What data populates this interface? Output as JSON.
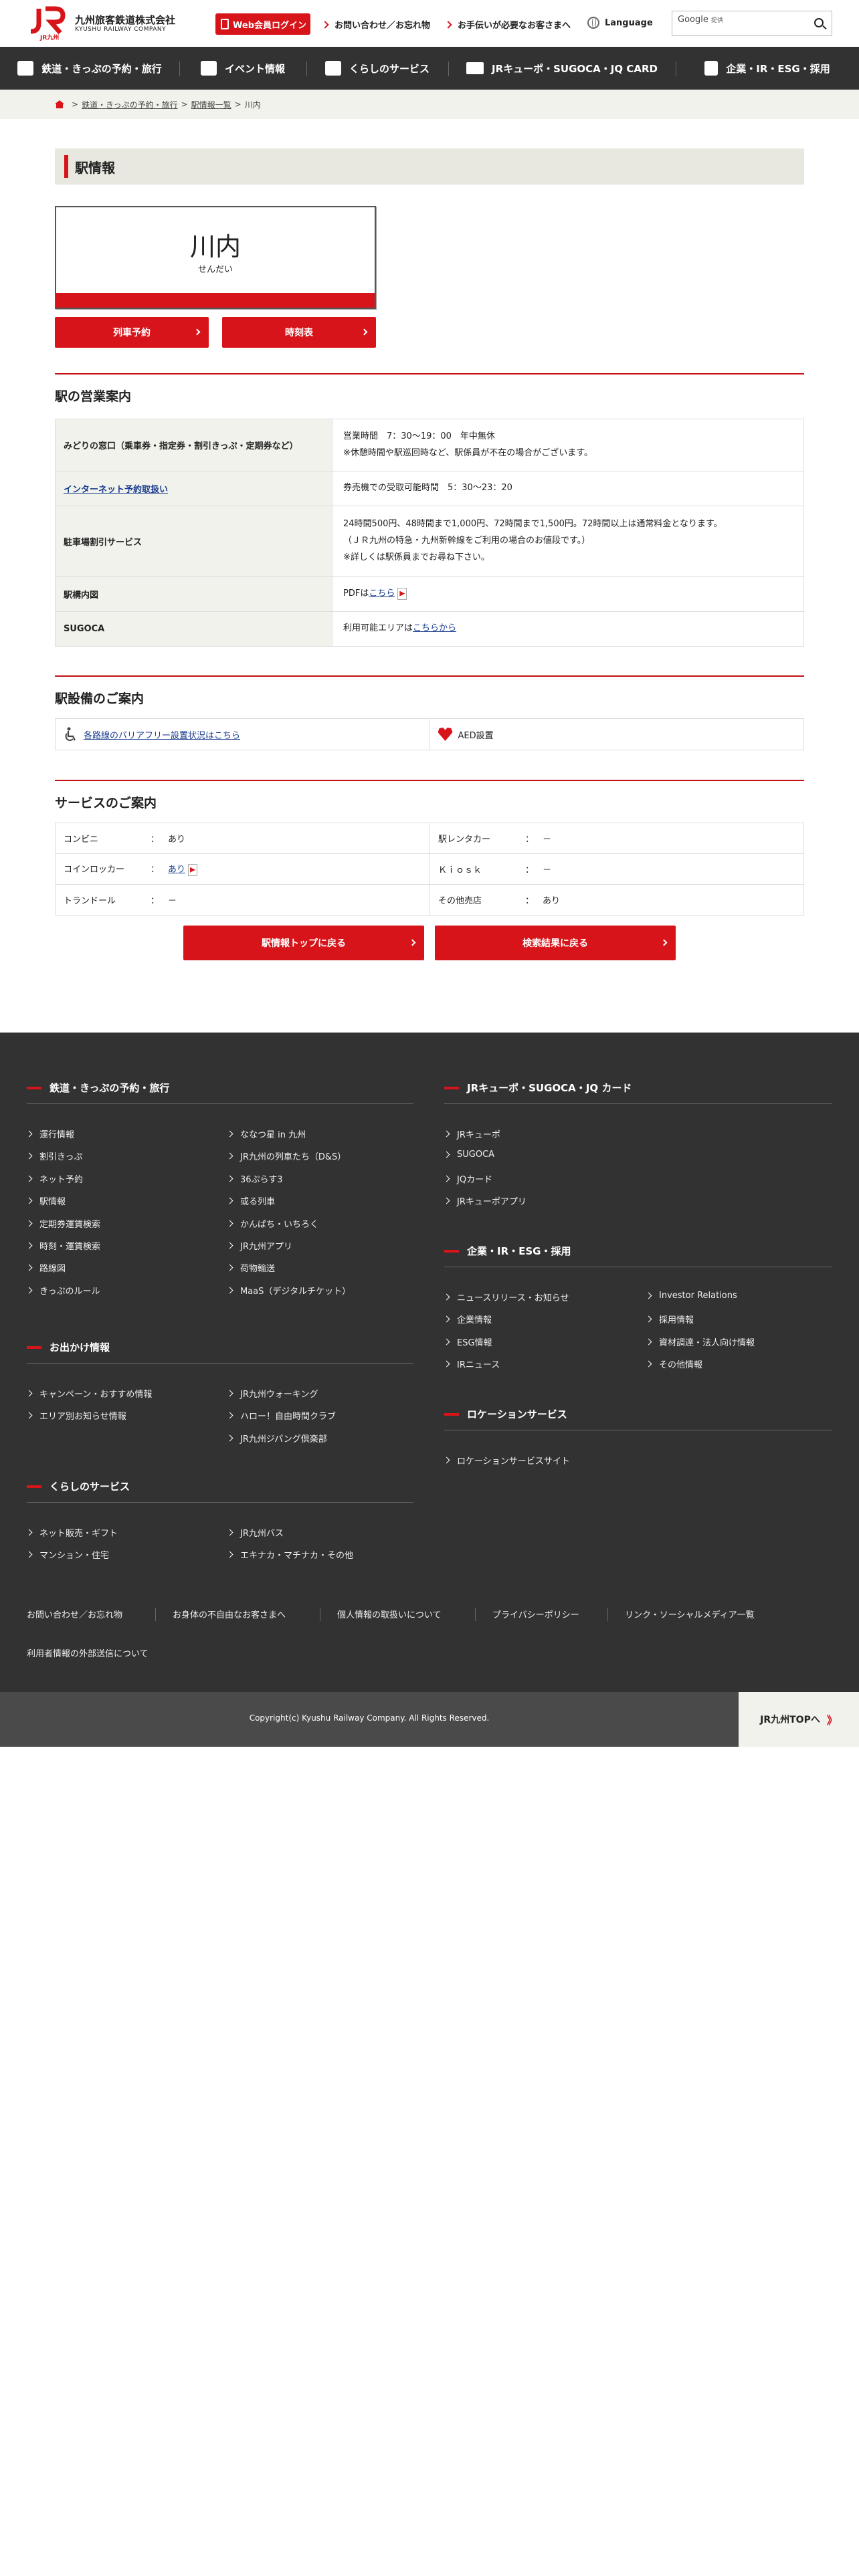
{
  "header": {
    "logo_jp": "九州旅客鉄道株式会社",
    "logo_en": "KYUSHU RAILWAY COMPANY",
    "logo_mark": "JR九州",
    "login_label": "Web会員ログイン",
    "contact_label": "お問い合わせ／お忘れ物",
    "assist_label": "お手伝いが必要なお客さまへ",
    "language_label": "Language",
    "search_brand": "Google",
    "search_brand_sub": "提供"
  },
  "nav": {
    "items": [
      {
        "label": "鉄道・きっぷの予約・旅行",
        "icon": "train-icon"
      },
      {
        "label": "イベント情報",
        "icon": "bag-icon"
      },
      {
        "label": "くらしのサービス",
        "icon": "box-icon"
      },
      {
        "label": "JRキューポ・SUGOCA・JQ CARD",
        "icon": "card-icon"
      },
      {
        "label": "企業・IR・ESG・採用",
        "icon": "building-icon"
      }
    ]
  },
  "breadcrumb": {
    "items": [
      "鉄道・きっぷの予約・旅行",
      "駅情報一覧",
      "川内"
    ],
    "separator": ">"
  },
  "main": {
    "page_title": "駅情報",
    "station": {
      "name": "川内",
      "kana": "せんだい"
    },
    "buttons": {
      "reserve": "列車予約",
      "timetable": "時刻表"
    },
    "business": {
      "heading": "駅の営業案内",
      "rows": [
        {
          "label": "みどりの窓口（乗車券・指定券・割引きっぷ・定期券など）",
          "line1": "営業時間　7：30〜19：00　年中無休",
          "line2": "※休憩時間や駅巡回時など、駅係員が不在の場合がございます。"
        },
        {
          "label": "インターネット予約取扱い",
          "line1": "券売機での受取可能時間　5：30〜23：20"
        },
        {
          "label": "駐車場割引サービス",
          "line1": "24時間500円、48時間まで1,000円、72時間まで1,500円。72時間以上は通常料金となります。",
          "line2": "（ＪＲ九州の特急・九州新幹線をご利用の場合のお値段です。）",
          "line3": "※詳しくは駅係員までお尋ね下さい。"
        },
        {
          "label": "駅構内図",
          "prefix": "PDFは",
          "link": "こちら"
        },
        {
          "label": "SUGOCA",
          "prefix": "利用可能エリアは",
          "link": "こちらから"
        }
      ]
    },
    "facilities": {
      "heading": "駅設備のご案内",
      "barrier_free": "各路線のバリアフリー設置状況はこちら",
      "aed": "AED設置"
    },
    "services": {
      "heading": "サービスのご案内",
      "colon": "：",
      "rows": [
        [
          {
            "k": "コンビニ",
            "v": "あり"
          },
          {
            "k": "駅レンタカー",
            "v": "－"
          }
        ],
        [
          {
            "k": "コインロッカー",
            "v": "あり"
          },
          {
            "k": "Ｋｉｏｓｋ",
            "v": "－"
          }
        ],
        [
          {
            "k": "トランドール",
            "v": "－"
          },
          {
            "k": "その他売店",
            "v": "あり"
          }
        ]
      ]
    },
    "bottom_buttons": {
      "back_top": "駅情報トップに戻る",
      "back_results": "検索結果に戻る"
    }
  },
  "footer": {
    "sections": {
      "rail": {
        "title": "鉄道・きっぷの予約・旅行",
        "col1": [
          "運行情報",
          "割引きっぷ",
          "ネット予約",
          "駅情報",
          "定期券運賃検索",
          "時刻・運賃検索",
          "路線図",
          "きっぷのルール"
        ],
        "col2": [
          "ななつ星 in 九州",
          "JR九州の列車たち（D&S）",
          "36ぷらす3",
          "或る列車",
          "かんぱち・いちろく",
          "JR九州アプリ",
          "荷物輸送",
          "MaaS（デジタルチケット）"
        ]
      },
      "outing": {
        "title": "お出かけ情報",
        "col1": [
          "キャンペーン・おすすめ情報",
          "エリア別お知らせ情報"
        ],
        "col2": [
          "JR九州ウォーキング",
          "ハロー！自由時間クラブ",
          "JR九州ジパング倶楽部"
        ]
      },
      "living": {
        "title": "くらしのサービス",
        "col1": [
          "ネット販売・ギフト",
          "マンション・住宅"
        ],
        "col2": [
          "JR九州バス",
          "エキナカ・マチナカ・その他"
        ]
      },
      "qpo": {
        "title": "JRキューポ・SUGOCA・JQ カード",
        "col1": [
          "JRキューポ",
          "SUGOCA",
          "JQカード",
          "JRキューポアプリ"
        ]
      },
      "corp": {
        "title": "企業・IR・ESG・採用",
        "col1": [
          "ニュースリリース・お知らせ",
          "企業情報",
          "ESG情報",
          "IRニュース"
        ],
        "col2": [
          "Investor Relations",
          "採用情報",
          "資材調達・法人向け情報",
          "その他情報"
        ]
      },
      "location": {
        "title": "ロケーションサービス",
        "col1": [
          "ロケーションサービスサイト"
        ]
      }
    },
    "bottom_links": [
      "お問い合わせ／お忘れ物",
      "お身体の不自由なお客さまへ",
      "個人情報の取扱いについて",
      "プライバシーポリシー",
      "リンク・ソーシャルメディア一覧",
      "利用者情報の外部送信について"
    ],
    "copyright": "Copyright(c) Kyushu Railway Company. All Rights Reserved.",
    "top_label": "JR九州TOPへ",
    "top_arrow": "》"
  },
  "colors": {
    "brand_red": "#d7141a",
    "dark": "#323232",
    "breadcrumb_bg": "#f2f2ec"
  }
}
